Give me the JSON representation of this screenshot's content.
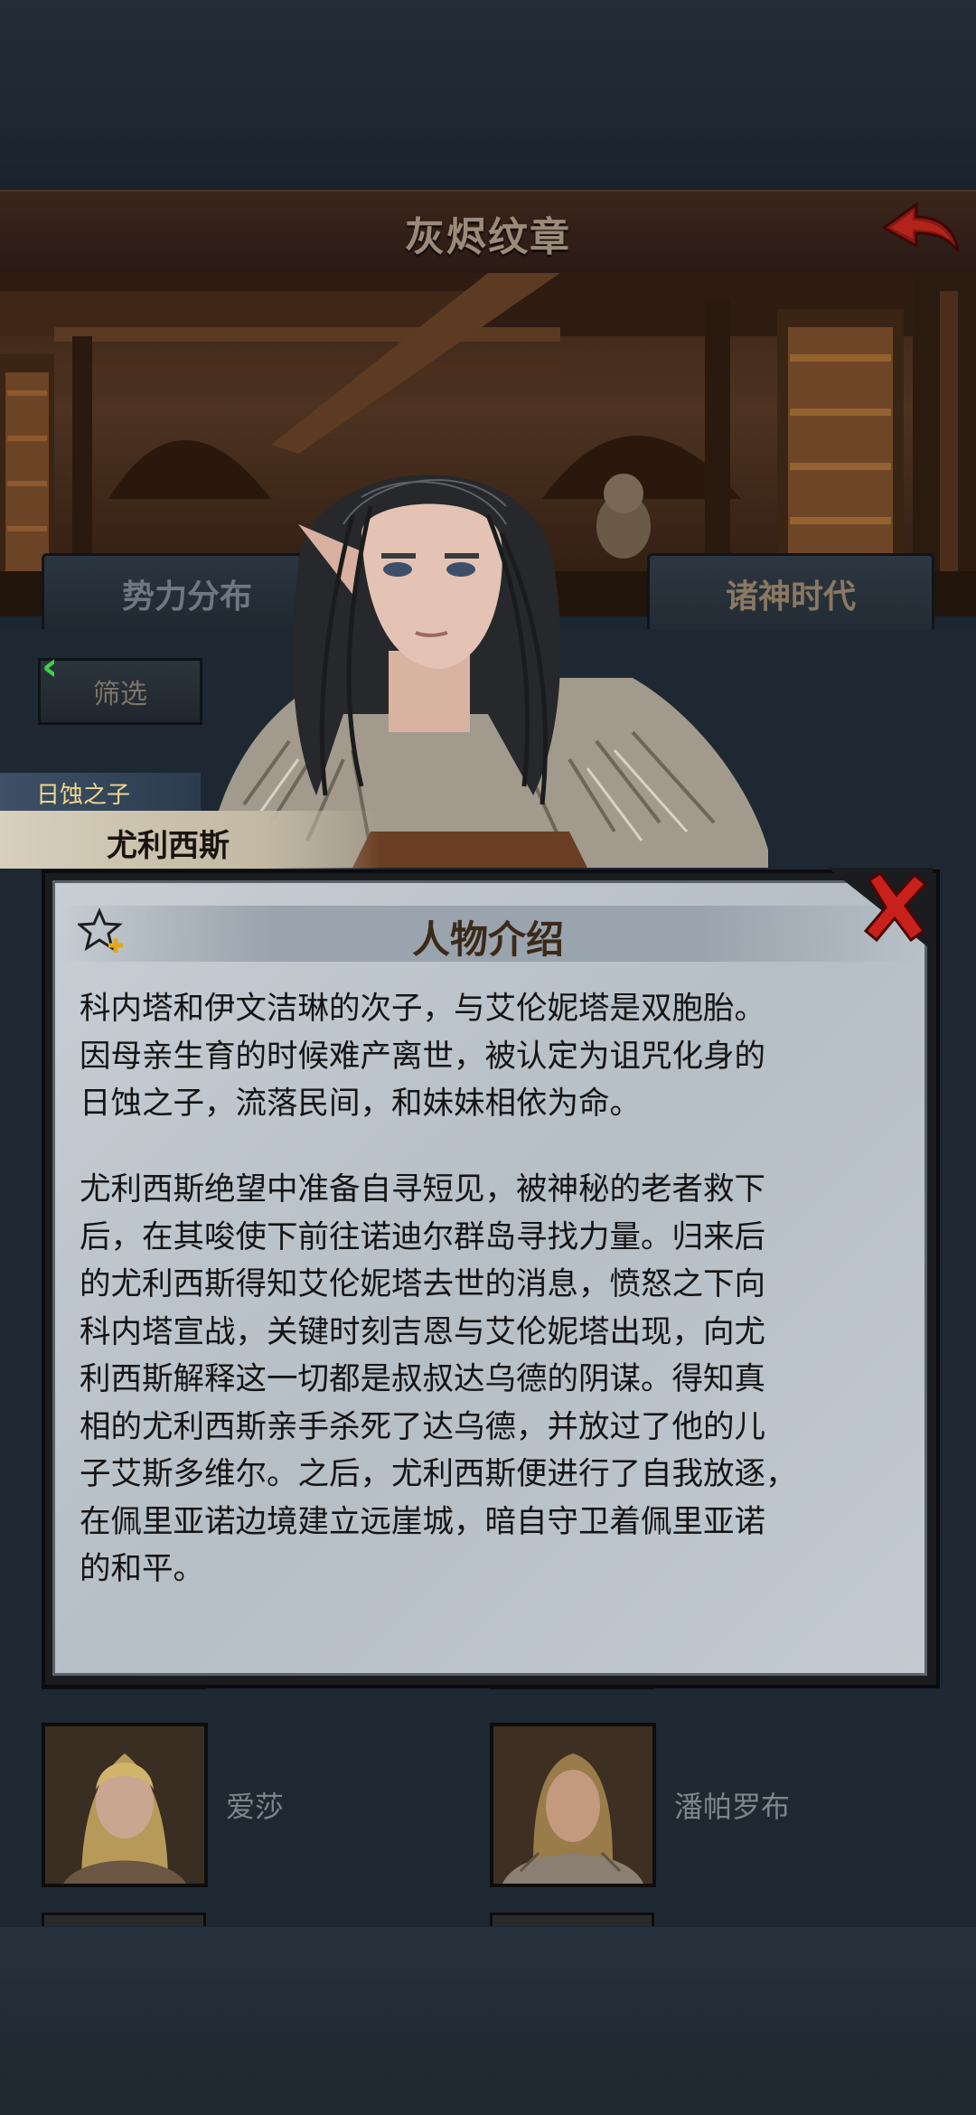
{
  "header": {
    "title": "灰烬纹章",
    "back_icon": "back-arrow-icon"
  },
  "tabs": [
    {
      "label": "势力分布",
      "active": false
    },
    {
      "label": "诸神时代",
      "active": true
    }
  ],
  "filter": {
    "label": "筛选",
    "arrow_icon": "chevron-left-icon"
  },
  "character": {
    "epithet": "日蚀之子",
    "name": "尤利西斯"
  },
  "modal": {
    "title": "人物介绍",
    "star_icon": "star-add-icon",
    "close_icon": "close-icon",
    "paragraphs": [
      "科内塔和伊文洁琳的次子，与艾伦妮塔是双胞胎。\n因母亲生育的时候难产离世，被认定为诅咒化身的\n日蚀之子，流落民间，和妹妹相依为命。",
      "尤利西斯绝望中准备自寻短见，被神秘的老者救下\n后，在其唆使下前往诺迪尔群岛寻找力量。归来后\n的尤利西斯得知艾伦妮塔去世的消息，愤怒之下向\n科内塔宣战，关键时刻吉恩与艾伦妮塔出现，向尤\n利西斯解释这一切都是叔叔达乌德的阴谋。得知真\n相的尤利西斯亲手杀死了达乌德，并放过了他的儿\n子艾斯多维尔。之后，尤利西斯便进行了自我放逐，\n在佩里亚诺边境建立远崖城，暗自守卫着佩里亚诺\n的和平。"
    ]
  },
  "characters": [
    {
      "name": "爱莎"
    },
    {
      "name": "潘帕罗布"
    }
  ],
  "colors": {
    "accent_gold": "#f0d68a",
    "close_red": "#c8211c",
    "filter_green": "#3ed24a"
  }
}
